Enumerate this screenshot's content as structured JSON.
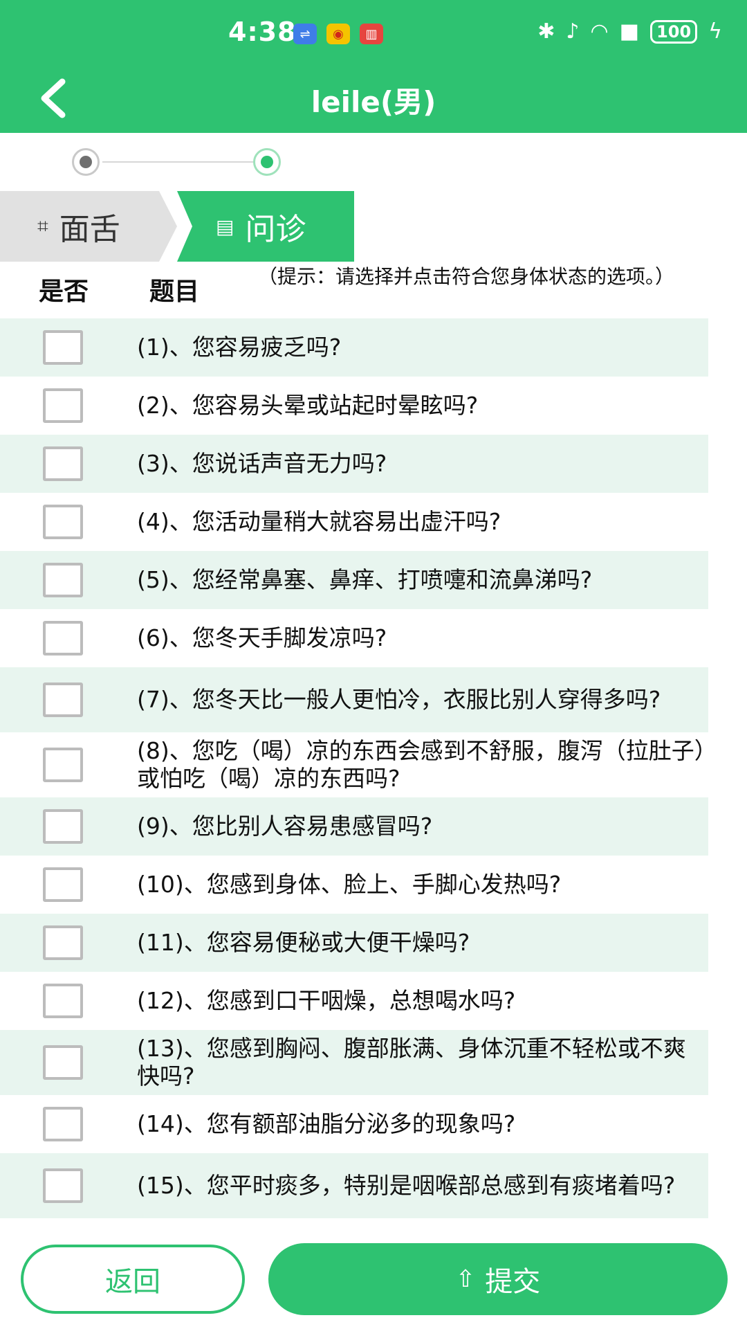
{
  "status_bar": {
    "time": "4:38",
    "battery": "100",
    "notif_icons": [
      "usb-icon",
      "weibo-icon",
      "book-icon"
    ],
    "sys_icons": [
      "bluetooth-icon",
      "mute-icon",
      "wifi-icon",
      "alert-icon",
      "battery-icon",
      "charging-icon"
    ]
  },
  "header": {
    "title": "leile(男)",
    "background": "#2ec271"
  },
  "steps": {
    "total": 2,
    "current": 2
  },
  "tabs": [
    {
      "label": "面舌",
      "icon": "face-scan-icon",
      "active": false
    },
    {
      "label": "问诊",
      "icon": "form-icon",
      "active": true
    }
  ],
  "table_header": {
    "yes_label": "是否",
    "title_label": "题目",
    "hint": "（提示：请选择并点击符合您身体状态的选项。）"
  },
  "questions": [
    {
      "text": "(1)、您容易疲乏吗?",
      "checked": false
    },
    {
      "text": "(2)、您容易头晕或站起时晕眩吗?",
      "checked": false
    },
    {
      "text": "(3)、您说话声音无力吗?",
      "checked": false
    },
    {
      "text": "(4)、您活动量稍大就容易出虚汗吗?",
      "checked": false
    },
    {
      "text": "(5)、您经常鼻塞、鼻痒、打喷嚏和流鼻涕吗?",
      "checked": false
    },
    {
      "text": "(6)、您冬天手脚发凉吗?",
      "checked": false
    },
    {
      "text": "(7)、您冬天比一般人更怕冷，衣服比别人穿得多吗?",
      "checked": false
    },
    {
      "text": "(8)、您吃（喝）凉的东西会感到不舒服，腹泻（拉肚子）或怕吃（喝）凉的东西吗?",
      "checked": false
    },
    {
      "text": "(9)、您比别人容易患感冒吗?",
      "checked": false
    },
    {
      "text": "(10)、您感到身体、脸上、手脚心发热吗?",
      "checked": false
    },
    {
      "text": "(11)、您容易便秘或大便干燥吗?",
      "checked": false
    },
    {
      "text": "(12)、您感到口干咽燥，总想喝水吗?",
      "checked": false
    },
    {
      "text": "(13)、您感到胸闷、腹部胀满、身体沉重不轻松或不爽快吗?",
      "checked": false
    },
    {
      "text": "(14)、您有额部油脂分泌多的现象吗?",
      "checked": false
    },
    {
      "text": "(15)、您平时痰多，特别是咽喉部总感到有痰堵着吗?",
      "checked": false
    }
  ],
  "buttons": {
    "back": "返回",
    "submit": "提交",
    "submit_icon": "upload-icon"
  },
  "colors": {
    "accent": "#2ec271",
    "row_alt": "#e8f5ef",
    "checkbox_border": "#bcbcbc"
  }
}
